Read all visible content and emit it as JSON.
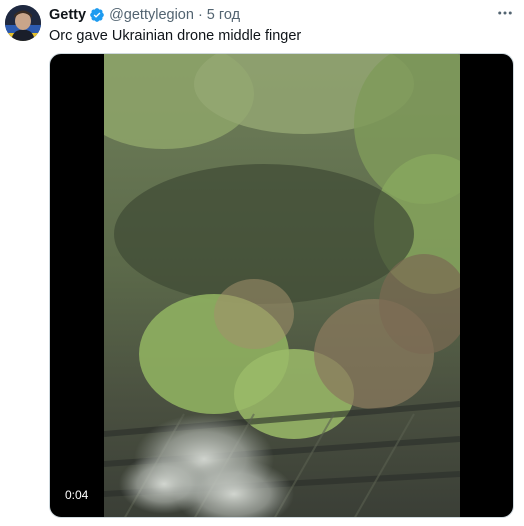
{
  "tweet": {
    "author": {
      "display_name": "Getty",
      "handle": "@gettylegion",
      "verified": true,
      "avatar_icon": "avatar-portrait"
    },
    "separator": "·",
    "timestamp": "5 год",
    "text": "Orc gave Ukrainian drone middle finger",
    "more_icon": "more-horizontal-icon",
    "media": {
      "type": "video",
      "duration": "0:04"
    }
  },
  "colors": {
    "verified": "#1d9bf0",
    "text_primary": "#0f1419",
    "text_secondary": "#536471",
    "media_background": "#000000"
  }
}
